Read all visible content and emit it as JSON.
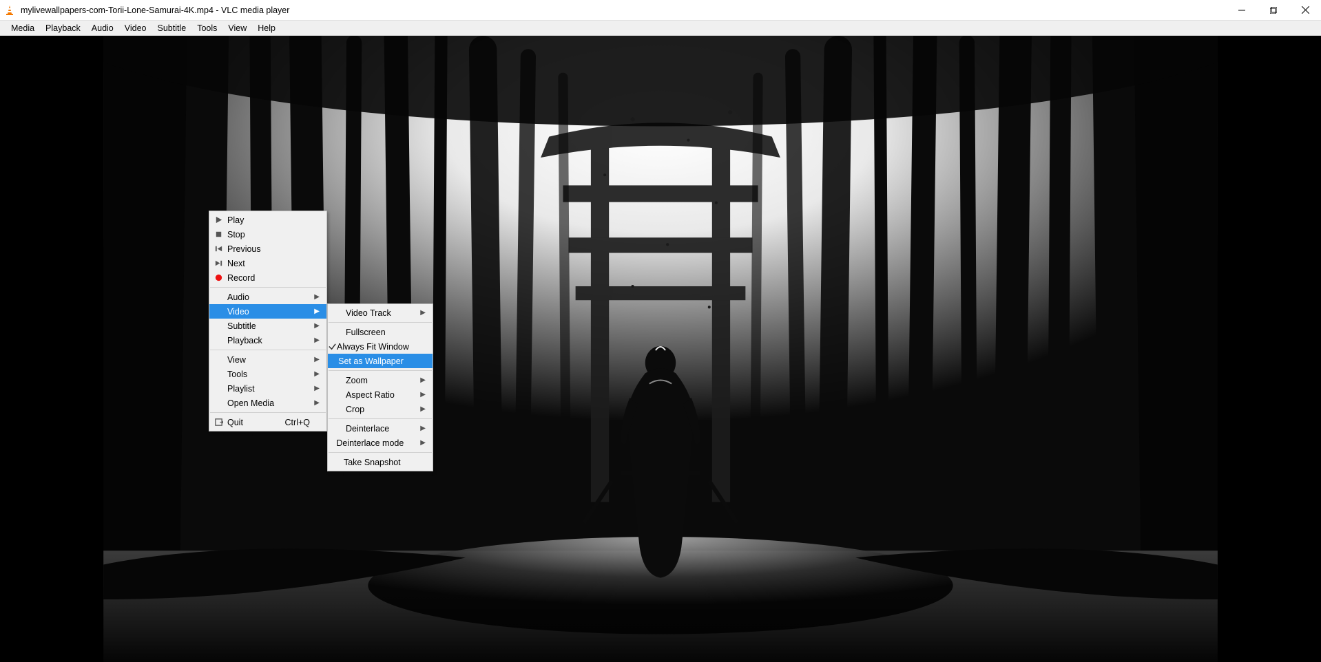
{
  "title": "mylivewallpapers-com-Torii-Lone-Samurai-4K.mp4 - VLC media player",
  "menubar": [
    "Media",
    "Playback",
    "Audio",
    "Video",
    "Subtitle",
    "Tools",
    "View",
    "Help"
  ],
  "ctx1": {
    "groups": [
      [
        {
          "icon": "play",
          "label": "Play"
        },
        {
          "icon": "stop",
          "label": "Stop"
        },
        {
          "icon": "prev",
          "label": "Previous"
        },
        {
          "icon": "next",
          "label": "Next"
        },
        {
          "icon": "rec",
          "label": "Record"
        }
      ],
      [
        {
          "label": "Audio",
          "sub": true
        },
        {
          "label": "Video",
          "sub": true,
          "selected": true
        },
        {
          "label": "Subtitle",
          "sub": true
        },
        {
          "label": "Playback",
          "sub": true
        }
      ],
      [
        {
          "label": "View",
          "sub": true
        },
        {
          "label": "Tools",
          "sub": true
        },
        {
          "label": "Playlist",
          "sub": true
        },
        {
          "label": "Open Media",
          "sub": true
        }
      ],
      [
        {
          "icon": "quit",
          "label": "Quit",
          "hint": "Ctrl+Q"
        }
      ]
    ]
  },
  "ctx2": {
    "groups": [
      [
        {
          "label": "Video Track",
          "sub": true
        }
      ],
      [
        {
          "label": "Fullscreen"
        },
        {
          "icon": "check",
          "label": "Always Fit Window"
        },
        {
          "label": "Set as Wallpaper",
          "selected": true
        }
      ],
      [
        {
          "label": "Zoom",
          "sub": true
        },
        {
          "label": "Aspect Ratio",
          "sub": true
        },
        {
          "label": "Crop",
          "sub": true
        }
      ],
      [
        {
          "label": "Deinterlace",
          "sub": true
        },
        {
          "label": "Deinterlace mode",
          "sub": true
        }
      ],
      [
        {
          "label": "Take Snapshot"
        }
      ]
    ]
  }
}
